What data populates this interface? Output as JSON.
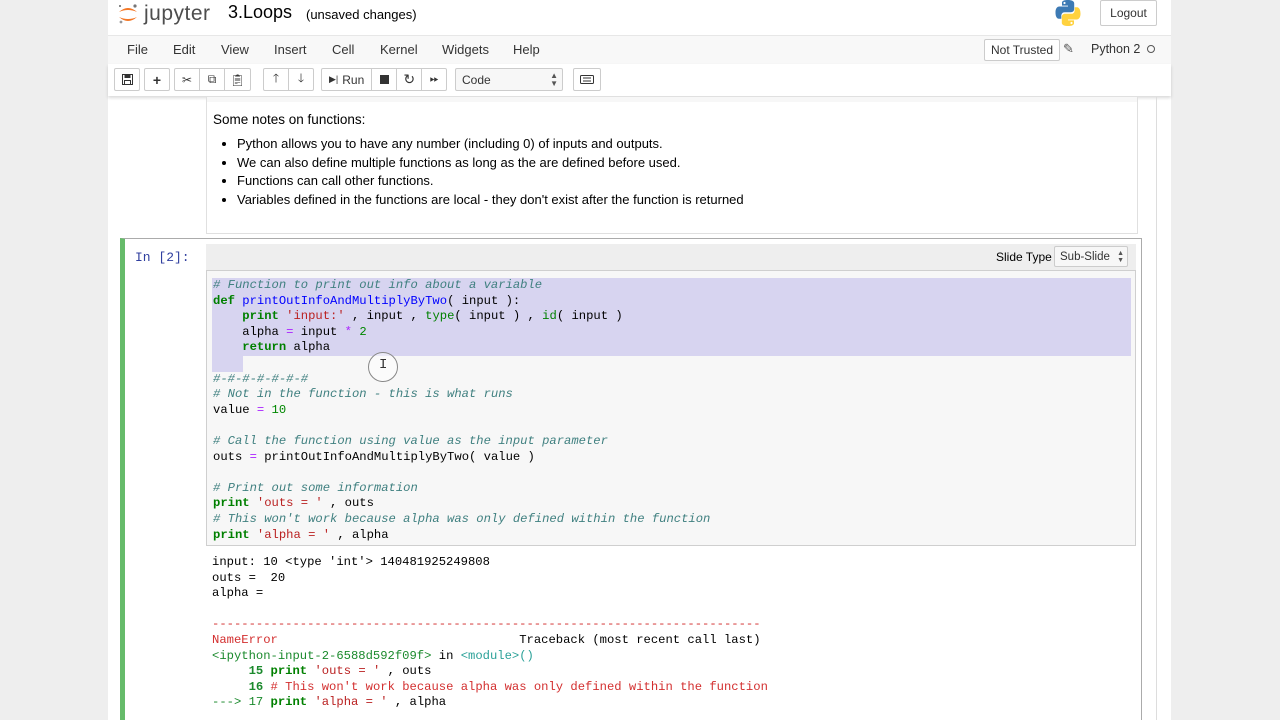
{
  "header": {
    "logo_text": "jupyter",
    "notebook_title": "3.Loops",
    "save_status": "(unsaved changes)",
    "logout_label": "Logout"
  },
  "menubar": {
    "items": [
      "File",
      "Edit",
      "View",
      "Insert",
      "Cell",
      "Kernel",
      "Widgets",
      "Help"
    ],
    "trust_label": "Not Trusted",
    "kernel_name": "Python 2"
  },
  "toolbar": {
    "run_label": "Run",
    "cell_type": "Code",
    "icons": [
      "save-icon",
      "plus-icon",
      "cut-icon",
      "copy-icon",
      "paste-icon",
      "arrow-up-icon",
      "arrow-down-icon",
      "run-icon",
      "stop-icon",
      "restart-icon",
      "fast-forward-icon",
      "keyboard-icon"
    ]
  },
  "markdown_cell": {
    "intro": "Some notes on functions:",
    "bullets": [
      "Python allows you to have any number (including 0) of inputs and outputs.",
      "We can also define multiple functions as long as the are defined before used.",
      "Functions can call other functions.",
      "Variables defined in the functions are local - they don't exist after the function is returned"
    ]
  },
  "code_cell": {
    "prompt": "In [2]:",
    "slide_type_label": "Slide Type",
    "slide_type_value": "Sub-Slide",
    "code_lines": [
      "# Function to print out info about a variable",
      "def printOutInfoAndMultiplyByTwo( input ):",
      "    print 'input:' , input , type( input ) , id( input )",
      "    alpha = input * 2",
      "    return alpha",
      "    ",
      "#-#-#-#-#-#-#",
      "# Not in the function - this is what runs",
      "value = 10",
      "",
      "# Call the function using value as the input parameter",
      "outs = printOutInfoAndMultiplyByTwo( value )",
      "",
      "# Print out some information",
      "print 'outs = ' , outs",
      "# This won't work because alpha was only defined within the function",
      "print 'alpha = ' , alpha"
    ],
    "output_lines": [
      "input: 10 <type 'int'> 140481925249808",
      "outs =  20",
      "alpha ="
    ],
    "traceback": {
      "separator": "---------------------------------------------------------------------------",
      "error_name": "NameError",
      "traceback_header": "Traceback (most recent call last)",
      "source": "<ipython-input-2-6588d592f09f>",
      "in_word": "in",
      "module": "<module>()",
      "lines": [
        {
          "marker": "     ",
          "num": "15",
          "code": "print 'outs = ' , outs"
        },
        {
          "marker": "     ",
          "num": "16",
          "code": "# This won't work because alpha was only defined within the function"
        },
        {
          "marker": "---> ",
          "num": "17",
          "code": "print 'alpha = ' , alpha"
        }
      ]
    }
  },
  "colors": {
    "prompt": "#303f9f",
    "selected_cell_border": "#66bb6a",
    "selection": "#d7d4f0",
    "error": "#d32f2f"
  }
}
